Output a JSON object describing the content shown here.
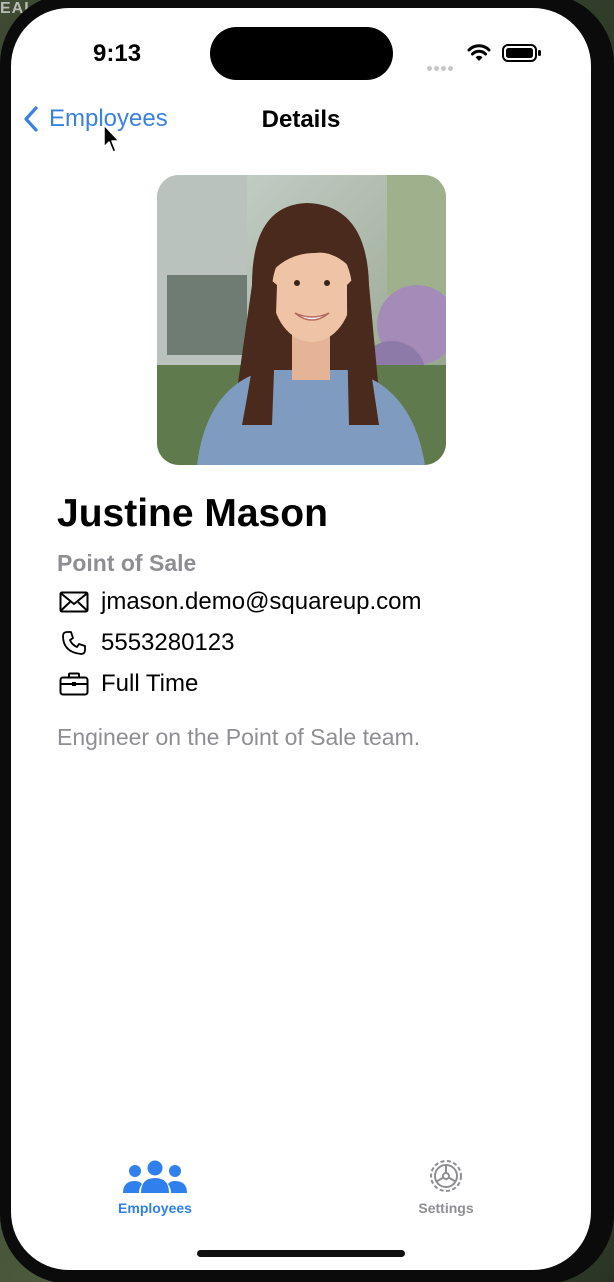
{
  "background": {
    "corner_text": "EAL"
  },
  "status_bar": {
    "time": "9:13"
  },
  "nav": {
    "back_label": "Employees",
    "title": "Details"
  },
  "employee": {
    "name": "Justine Mason",
    "team": "Point of Sale",
    "email": "jmason.demo@squareup.com",
    "phone": "5553280123",
    "employment_type": "Full Time",
    "bio": "Engineer on the Point of Sale team."
  },
  "tabs": [
    {
      "label": "Employees",
      "icon": "people-icon",
      "selected": true
    },
    {
      "label": "Settings",
      "icon": "gear-icon",
      "selected": false
    }
  ],
  "colors": {
    "accent": "#2f80ed",
    "secondary_text": "#8e8e93"
  }
}
